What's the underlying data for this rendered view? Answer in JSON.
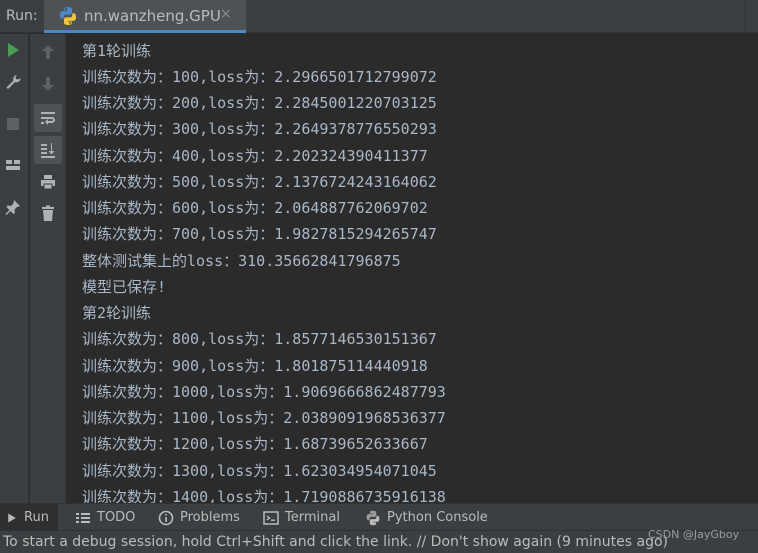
{
  "runbar": {
    "label": "Run:",
    "tab_title": "nn.wanzheng.GPU",
    "close_glyph": "×"
  },
  "left_toolbar": [
    {
      "icon": "play-icon",
      "color": "#499c54"
    },
    {
      "icon": "wrench-icon"
    },
    {
      "icon": "stop-icon"
    },
    {
      "icon": "layout-icon"
    },
    {
      "icon": "pin-icon"
    }
  ],
  "right_toolbar": [
    {
      "icon": "arrow-up-icon"
    },
    {
      "icon": "arrow-down-icon"
    },
    {
      "icon": "soft-wrap-icon",
      "active": true
    },
    {
      "icon": "scroll-to-end-icon",
      "active": true
    },
    {
      "icon": "print-icon"
    },
    {
      "icon": "trash-icon"
    }
  ],
  "console": {
    "lines": [
      "第1轮训练",
      "训练次数为：100,loss为：2.2966501712799072",
      "训练次数为：200,loss为：2.2845001220703125",
      "训练次数为：300,loss为：2.2649378776550293",
      "训练次数为：400,loss为：2.202324390411377",
      "训练次数为：500,loss为：2.1376724243164062",
      "训练次数为：600,loss为：2.064887762069702",
      "训练次数为：700,loss为：1.9827815294265747",
      "整体测试集上的loss：310.35662841796875",
      "模型已保存!",
      "第2轮训练",
      "训练次数为：800,loss为：1.8577146530151367",
      "训练次数为：900,loss为：1.801875114440918",
      "训练次数为：1000,loss为：1.9069666862487793",
      "训练次数为：1100,loss为：2.0389091968536377",
      "训练次数为：1200,loss为：1.68739652633667",
      "训练次数为：1300,loss为：1.623034954071045",
      "训练次数为：1400,loss为：1.7190886735916138"
    ]
  },
  "bottom_tabs": [
    {
      "label": "Run",
      "icon": "play-icon",
      "active": true
    },
    {
      "label": "TODO",
      "icon": "list-icon"
    },
    {
      "label": "Problems",
      "icon": "info-icon"
    },
    {
      "label": "Terminal",
      "icon": "terminal-icon"
    },
    {
      "label": "Python Console",
      "icon": "python-icon"
    }
  ],
  "status": {
    "message": "To start a debug session, hold Ctrl+Shift and click the link. // Don't show again (9 minutes ago)",
    "watermark": "CSDN @JayGboy"
  },
  "colors": {
    "accent": "#4a88c7",
    "run_green": "#499c54",
    "text": "#a9b7c6"
  }
}
